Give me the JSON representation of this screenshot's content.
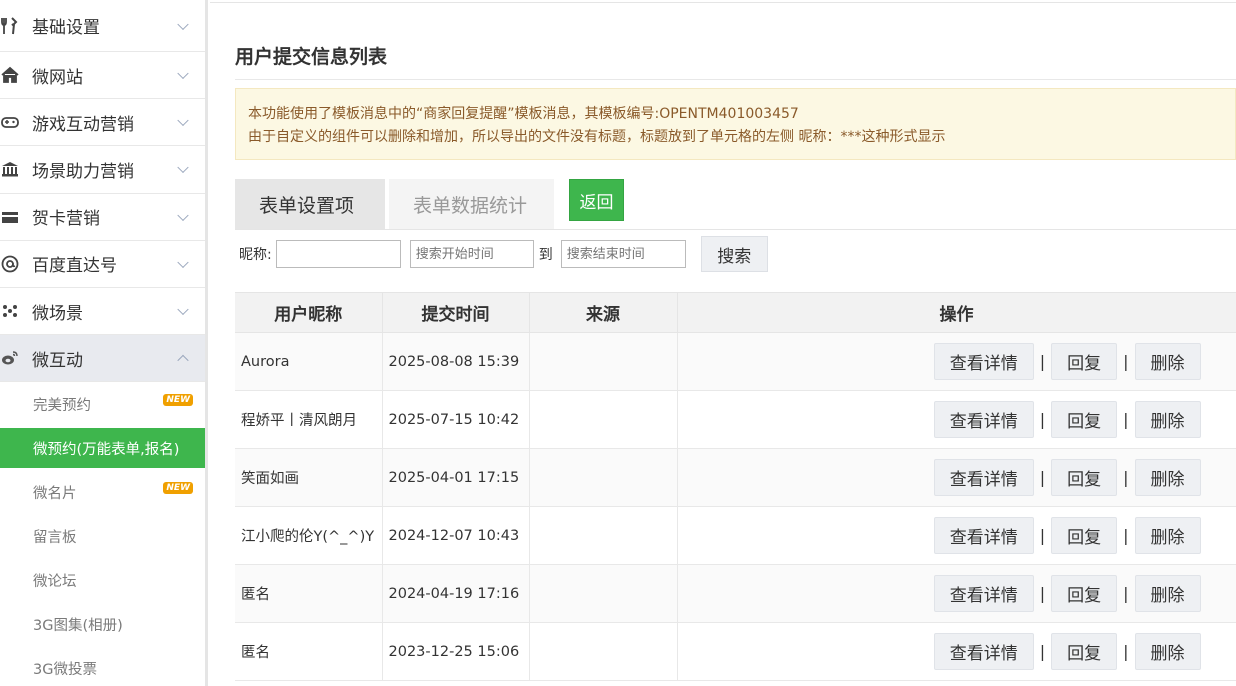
{
  "sidebar": {
    "items": [
      {
        "label": "基础设置",
        "icon": "tools-icon"
      },
      {
        "label": "微网站",
        "icon": "home-icon"
      },
      {
        "label": "游戏互动营销",
        "icon": "gamepad-icon"
      },
      {
        "label": "场景助力营销",
        "icon": "bank-icon"
      },
      {
        "label": "贺卡营销",
        "icon": "card-icon"
      },
      {
        "label": "百度直达号",
        "icon": "at-icon"
      },
      {
        "label": "微场景",
        "icon": "dots-icon"
      },
      {
        "label": "微互动",
        "icon": "weibo-icon"
      }
    ],
    "sub_items": [
      {
        "label": "完美预约",
        "badge": "NEW"
      },
      {
        "label": "微预约(万能表单,报名)",
        "badge": ""
      },
      {
        "label": "微名片",
        "badge": "NEW"
      },
      {
        "label": "留言板",
        "badge": ""
      },
      {
        "label": "微论坛",
        "badge": ""
      },
      {
        "label": "3G图集(相册)",
        "badge": ""
      },
      {
        "label": "3G微投票",
        "badge": ""
      }
    ]
  },
  "main": {
    "title": "用户提交信息列表",
    "notice_line1": "本功能使用了模板消息中的“商家回复提醒”模板消息，其模板编号:OPENTM401003457",
    "notice_line2": "由于自定义的组件可以删除和增加，所以导出的文件没有标题，标题放到了单元格的左侧 昵称：***这种形式显示",
    "tabs": [
      "表单设置项",
      "表单数据统计"
    ],
    "back_label": "返回"
  },
  "search": {
    "nick_label": "昵称:",
    "nick_value": "",
    "start_placeholder": "搜索开始时间",
    "to_label": "到",
    "end_placeholder": "搜索结束时间",
    "button": "搜索"
  },
  "table": {
    "headers": [
      "用户昵称",
      "提交时间",
      "来源",
      "操作"
    ],
    "rows": [
      {
        "nick": "Aurora",
        "time": "2025-08-08 15:39",
        "source": ""
      },
      {
        "nick": "程娇平丨清风朗月",
        "time": "2025-07-15 10:42",
        "source": ""
      },
      {
        "nick": "笑面如画",
        "time": "2025-04-01 17:15",
        "source": ""
      },
      {
        "nick": "江小爬的伦Y(^_^)Y",
        "time": "2024-12-07 10:43",
        "source": ""
      },
      {
        "nick": "匿名",
        "time": "2024-04-19 17:16",
        "source": ""
      },
      {
        "nick": "匿名",
        "time": "2023-12-25 15:06",
        "source": ""
      }
    ],
    "ops": {
      "detail": "查看详情",
      "reply": "回复",
      "delete": "删除",
      "sep": "|"
    }
  },
  "colors": {
    "accent": "#3eb64d",
    "notice_bg": "#fcf8e3",
    "badge": "#f0a000"
  }
}
